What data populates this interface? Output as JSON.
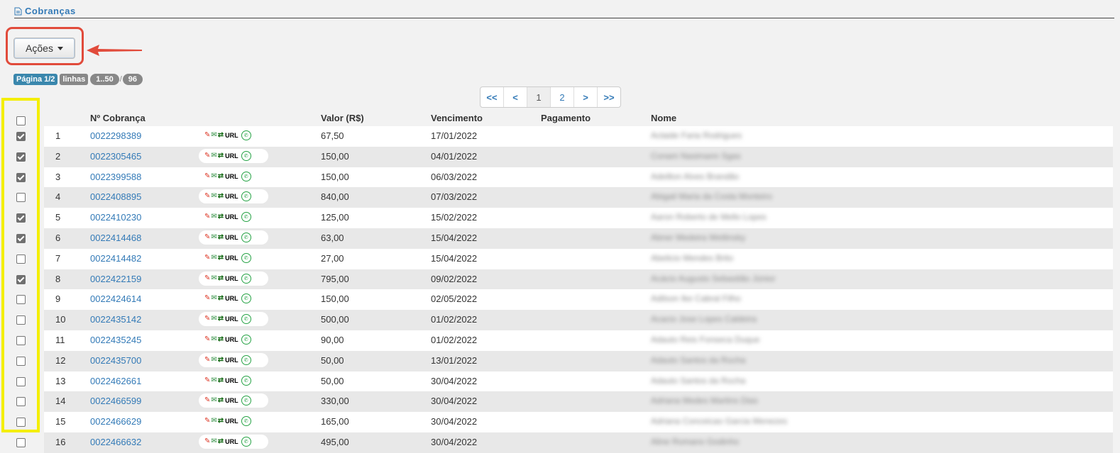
{
  "header": {
    "title": "Cobranças",
    "icon": "document-icon"
  },
  "actions": {
    "label": "Ações",
    "highlight_color": "#e14b3b"
  },
  "pagination_info": {
    "page_label": "Página 1/2",
    "rows_label": "linhas",
    "range": "1..50",
    "total": "96"
  },
  "pager": {
    "first": "<<",
    "prev": "<",
    "pages": [
      "1",
      "2"
    ],
    "active": "1",
    "next": ">",
    "last": ">>"
  },
  "table": {
    "columns": [
      "Nº Cobrança",
      "Valor (R$)",
      "Vencimento",
      "Pagamento",
      "Nome"
    ],
    "actions_icons": [
      "pdf-icon",
      "email-icon",
      "swap-icon",
      "url-label",
      "whatsapp-icon"
    ],
    "url_label": "URL",
    "rows": [
      {
        "n": "1",
        "id": "0022298389",
        "valor": "67,50",
        "venc": "17/01/2022",
        "pag": "",
        "nome": "Aclaide Faria Rodrigues",
        "checked": true
      },
      {
        "n": "2",
        "id": "0022305465",
        "valor": "150,00",
        "venc": "04/01/2022",
        "pag": "",
        "nome": "Conam Nasimann Sgas",
        "checked": true
      },
      {
        "n": "3",
        "id": "0022399588",
        "valor": "150,00",
        "venc": "06/03/2022",
        "pag": "",
        "nome": "Adeilton Alves Brandão",
        "checked": true
      },
      {
        "n": "4",
        "id": "0022408895",
        "valor": "840,00",
        "venc": "07/03/2022",
        "pag": "",
        "nome": "Abigail Maria da Costa Monteiro",
        "checked": false
      },
      {
        "n": "5",
        "id": "0022410230",
        "valor": "125,00",
        "venc": "15/02/2022",
        "pag": "",
        "nome": "Aaron Roberto de Mello Lopes",
        "checked": true
      },
      {
        "n": "6",
        "id": "0022414468",
        "valor": "63,00",
        "venc": "15/04/2022",
        "pag": "",
        "nome": "Abner Medeira Wetlinsky",
        "checked": true
      },
      {
        "n": "7",
        "id": "0022414482",
        "valor": "27,00",
        "venc": "15/04/2022",
        "pag": "",
        "nome": "Abelicio Mendes Brito",
        "checked": false
      },
      {
        "n": "8",
        "id": "0022422159",
        "valor": "795,00",
        "venc": "09/02/2022",
        "pag": "",
        "nome": "Acácio Augusto Sebastião Júnior",
        "checked": true
      },
      {
        "n": "9",
        "id": "0022424614",
        "valor": "150,00",
        "venc": "02/05/2022",
        "pag": "",
        "nome": "Adilson Ike Cabral Filho",
        "checked": false
      },
      {
        "n": "10",
        "id": "0022435142",
        "valor": "500,00",
        "venc": "01/02/2022",
        "pag": "",
        "nome": "Acacio Jose Lopes Caldeira",
        "checked": false
      },
      {
        "n": "11",
        "id": "0022435245",
        "valor": "90,00",
        "venc": "01/02/2022",
        "pag": "",
        "nome": "Adauto Reis Fonseca Duque",
        "checked": false
      },
      {
        "n": "12",
        "id": "0022435700",
        "valor": "50,00",
        "venc": "13/01/2022",
        "pag": "",
        "nome": "Adauto Santos da Rocha",
        "checked": false
      },
      {
        "n": "13",
        "id": "0022462661",
        "valor": "50,00",
        "venc": "30/04/2022",
        "pag": "",
        "nome": "Adauto Santos da Rocha",
        "checked": false
      },
      {
        "n": "14",
        "id": "0022466599",
        "valor": "330,00",
        "venc": "30/04/2022",
        "pag": "",
        "nome": "Adriana Medes Martins Dias",
        "checked": false
      },
      {
        "n": "15",
        "id": "0022466629",
        "valor": "165,00",
        "venc": "30/04/2022",
        "pag": "",
        "nome": "Adriana Conceicao Garcia Menezes",
        "checked": false
      },
      {
        "n": "16",
        "id": "0022466632",
        "valor": "495,00",
        "venc": "30/04/2022",
        "pag": "",
        "nome": "Aline Romano Godinho",
        "checked": false
      }
    ]
  }
}
